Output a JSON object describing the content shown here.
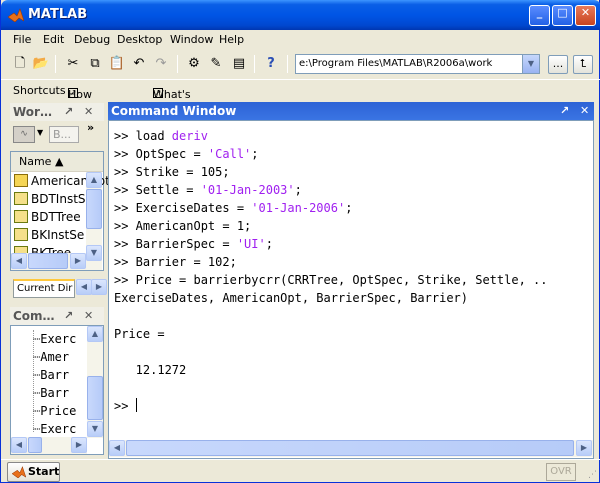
{
  "window": {
    "title": "MATLAB"
  },
  "menu": [
    "File",
    "Edit",
    "Debug",
    "Desktop",
    "Window",
    "Help"
  ],
  "toolbar": {
    "current_directory": "e:\\Program Files\\MATLAB\\R2006a\\work",
    "browse_label": "...",
    "icons": [
      "new-file-icon",
      "open-folder-icon",
      "cut-icon",
      "copy-icon",
      "paste-icon",
      "undo-icon",
      "redo-icon",
      "simulink-icon",
      "guide-icon",
      "profiler-icon",
      "help-icon"
    ]
  },
  "shortcuts": {
    "label": "Shortcuts",
    "items": [
      "How to Add",
      "What's New"
    ]
  },
  "workspace": {
    "title": "Wor…",
    "view_label": "B...",
    "column": "Name ▲",
    "items": [
      "AmericanOpt",
      "BDTInstS",
      "BDTTree",
      "BKInstSe",
      "BKTree"
    ],
    "tabs": [
      "Current Dir"
    ]
  },
  "history": {
    "title": "Com…",
    "items": [
      "Exerc",
      "Amer",
      "Barr",
      "Barr",
      "Price",
      "Exerc"
    ]
  },
  "command_window": {
    "title": "Command Window",
    "lines": [
      [
        {
          "t": ">> load "
        },
        {
          "t": "deriv",
          "c": "kw"
        }
      ],
      [
        {
          "t": ">> OptSpec = "
        },
        {
          "t": "'Call'",
          "c": "str"
        },
        {
          "t": ";"
        }
      ],
      [
        {
          "t": ">> Strike = 105;"
        }
      ],
      [
        {
          "t": ">> Settle = "
        },
        {
          "t": "'01-Jan-2003'",
          "c": "str"
        },
        {
          "t": ";"
        }
      ],
      [
        {
          "t": ">> ExerciseDates = "
        },
        {
          "t": "'01-Jan-2006'",
          "c": "str"
        },
        {
          "t": ";"
        }
      ],
      [
        {
          "t": ">> AmericanOpt = 1;"
        }
      ],
      [
        {
          "t": ">> BarrierSpec = "
        },
        {
          "t": "'UI'",
          "c": "str"
        },
        {
          "t": ";"
        }
      ],
      [
        {
          "t": ">> Barrier = 102;"
        }
      ],
      [
        {
          "t": ">> Price = barrierbycrr(CRRTree, OptSpec, Strike, Settle, .."
        }
      ],
      [
        {
          "t": "ExerciseDates, AmericanOpt, BarrierSpec, Barrier)"
        }
      ],
      [
        {
          "t": ""
        }
      ],
      [
        {
          "t": "Price ="
        }
      ],
      [
        {
          "t": ""
        }
      ],
      [
        {
          "t": "   12.1272"
        }
      ],
      [
        {
          "t": ""
        }
      ],
      [
        {
          "t": ">> "
        },
        {
          "caret": true
        }
      ]
    ]
  },
  "status": {
    "start_label": "Start",
    "ovr": "OVR"
  },
  "colors": {
    "string": "#a020f0",
    "titlebar": "#0055e5"
  }
}
